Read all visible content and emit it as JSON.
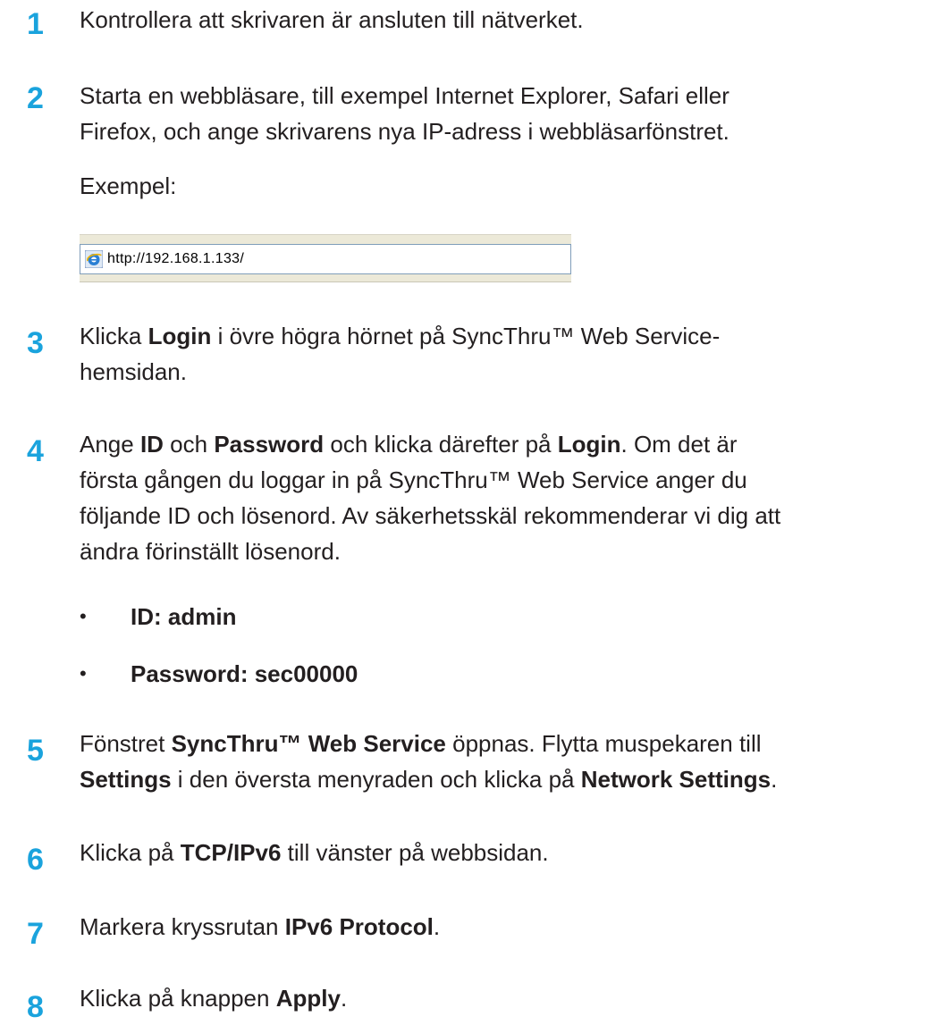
{
  "steps": [
    {
      "number": "1",
      "text": "Kontrollera att skrivaren är ansluten till nätverket."
    },
    {
      "number": "2",
      "line1": "Starta en webbläsare, till exempel Internet Explorer, Safari eller",
      "line2": "Firefox, och ange skrivarens nya IP-adress i webbläsarfönstret.",
      "example_label": "Exempel:",
      "address": "http://192.168.1.133/"
    },
    {
      "number": "3",
      "t1": "Klicka ",
      "b1": "Login",
      "t2": " i övre högra hörnet på SyncThru™ Web Service-",
      "line2": "hemsidan."
    },
    {
      "number": "4",
      "t1": "Ange ",
      "b1": "ID",
      "t2": " och ",
      "b2": "Password",
      "t3": " och klicka därefter på ",
      "b3": "Login",
      "t4": ". Om det är",
      "line2": "första gången du loggar in på SyncThru™ Web Service anger du",
      "line3": "följande ID och lösenord. Av säkerhetsskäl rekommenderar vi dig att",
      "line4": "ändra förinställt lösenord.",
      "bullets": [
        "ID: admin",
        "Password: sec00000"
      ],
      "bullet_symbol": "•"
    },
    {
      "number": "5",
      "t1": "Fönstret ",
      "b1": "SyncThru™ Web Service",
      "t2": " öppnas. Flytta muspekaren till",
      "b2": "Settings",
      "t3": " i den översta menyraden och klicka på ",
      "b3": "Network Settings",
      "t4": "."
    },
    {
      "number": "6",
      "t1": "Klicka på ",
      "b1": "TCP/IPv6",
      "t2": " till vänster på webbsidan."
    },
    {
      "number": "7",
      "t1": "Markera kryssrutan ",
      "b1": "IPv6 Protocol",
      "t2": "."
    },
    {
      "number": "8",
      "t1": "Klicka på knappen ",
      "b1": "Apply",
      "t2": "."
    }
  ],
  "colors": {
    "step_number": "#1aa3dd",
    "text": "#231f20"
  },
  "icons": {
    "browser": "internet-explorer-icon"
  }
}
